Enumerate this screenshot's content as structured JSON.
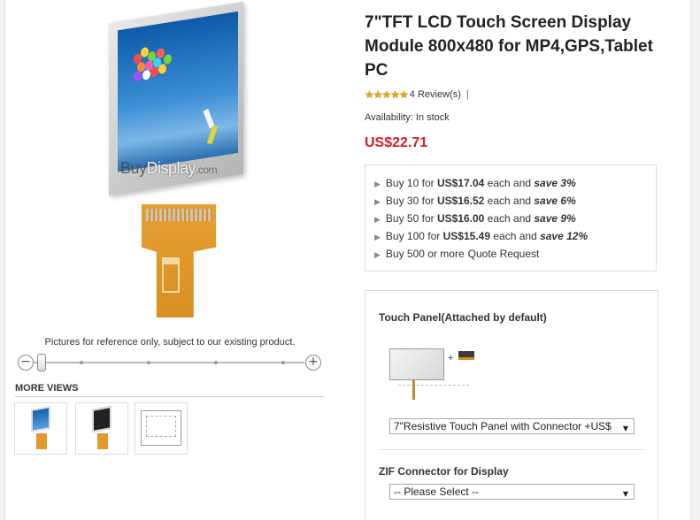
{
  "product": {
    "title": "7\"TFT LCD Touch Screen Display Module 800x480 for MP4,GPS,Tablet PC",
    "rating": {
      "stars_text": "★★★★★",
      "value": 4.5,
      "max": 5,
      "reviews_label": "4 Review(s)",
      "separator": "|"
    },
    "availability": "Availability: In stock",
    "price": "US$22.71"
  },
  "image": {
    "watermark": {
      "part1": "Buy",
      "part2": "Display",
      "part3": ".com"
    },
    "reference_note": "Pictures for reference only, subject to our existing product.",
    "zoom": {
      "out_symbol": "−",
      "in_symbol": "+",
      "level": 0.1
    }
  },
  "more_views": {
    "title": "MORE VIEWS",
    "count": 3
  },
  "tier_pricing": [
    {
      "prefix": "Buy 10 for ",
      "price": "US$17.04",
      "middle": " each and ",
      "save": "save 3%"
    },
    {
      "prefix": "Buy 30 for ",
      "price": "US$16.52",
      "middle": " each and ",
      "save": "save 6%"
    },
    {
      "prefix": "Buy 50 for ",
      "price": "US$16.00",
      "middle": " each and ",
      "save": "save 9%"
    },
    {
      "prefix": "Buy 100 for ",
      "price": "US$15.49",
      "middle": " each and ",
      "save": "save 12%"
    }
  ],
  "quote": {
    "prefix": "Buy 500 or more",
    "link": "Quote Request"
  },
  "options": {
    "touch_panel": {
      "label": "Touch Panel(Attached by default)",
      "plus": "+",
      "selected": "7\"Resistive Touch Panel with Connector +US$"
    },
    "zif": {
      "label": "ZIF Connector for Display",
      "selected": "-- Please Select --"
    },
    "caret": "▼"
  },
  "colors": {
    "price": "#d21f1f",
    "stars": "#e8a317",
    "border": "#dddddd"
  }
}
